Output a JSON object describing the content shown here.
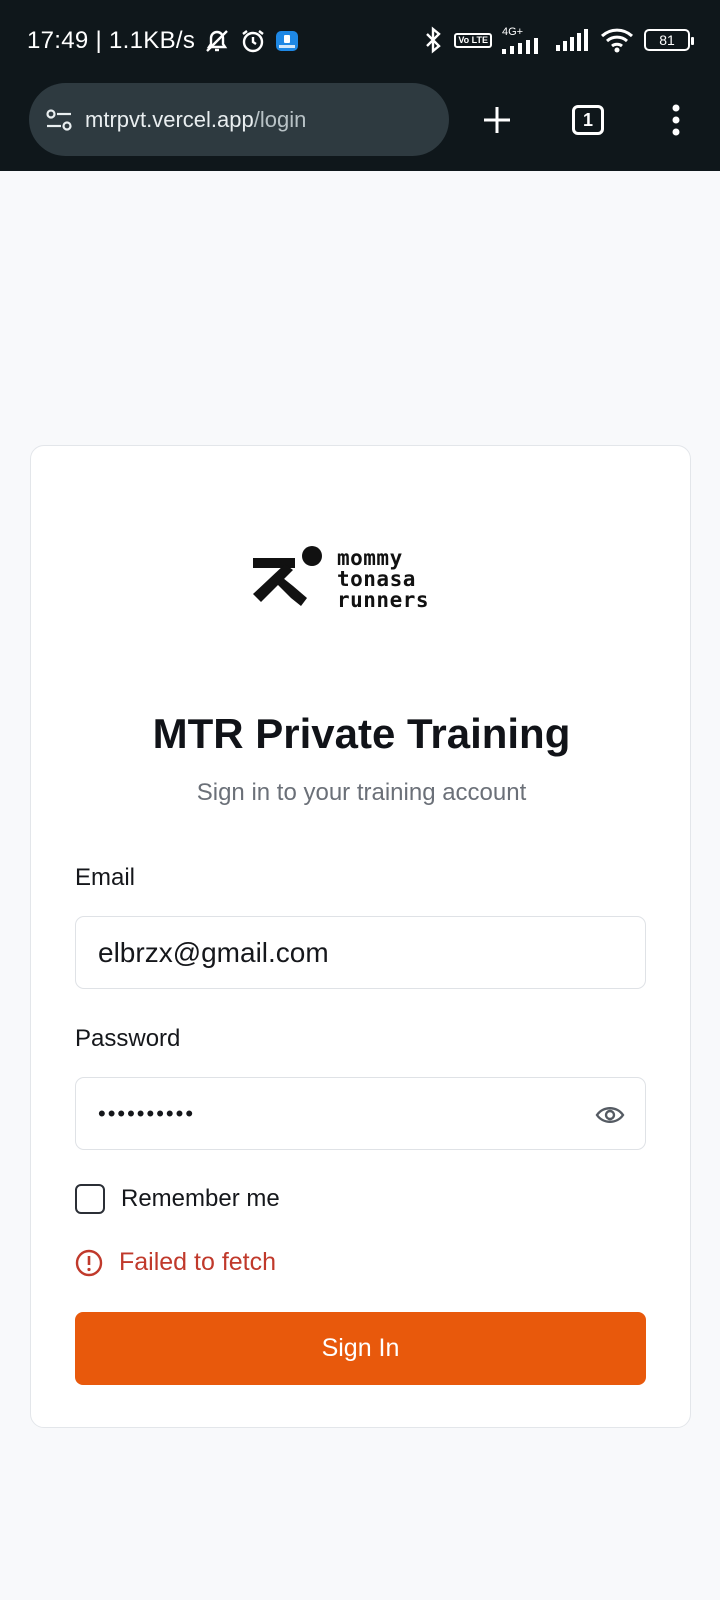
{
  "status_bar": {
    "time_speed": "17:49 | 1.1KB/s",
    "network_type": "4G+",
    "volte": "Vo LTE",
    "battery": "81"
  },
  "browser": {
    "url_host": "mtrpvt.vercel.app",
    "url_path": "/login",
    "tab_count": "1"
  },
  "logo": {
    "line1": "mommy",
    "line2": "tonasa",
    "line3": "runners"
  },
  "login": {
    "title": "MTR Private Training",
    "subtitle": "Sign in to your training account",
    "email_label": "Email",
    "email_value": "elbrzx@gmail.com",
    "password_label": "Password",
    "password_mask": "••••••••••",
    "remember_label": "Remember me",
    "error_message": "Failed to fetch",
    "submit_label": "Sign In"
  },
  "colors": {
    "accent": "#e8590c",
    "error": "#c0392b",
    "chrome_bg": "#0f171b"
  },
  "icons": [
    "mute-icon",
    "alarm-icon",
    "app-notification-icon",
    "bluetooth-icon",
    "signal-icon",
    "wifi-icon",
    "battery-icon",
    "site-settings-icon",
    "new-tab-icon",
    "tab-switcher-icon",
    "more-menu-icon",
    "show-password-icon",
    "error-icon"
  ]
}
